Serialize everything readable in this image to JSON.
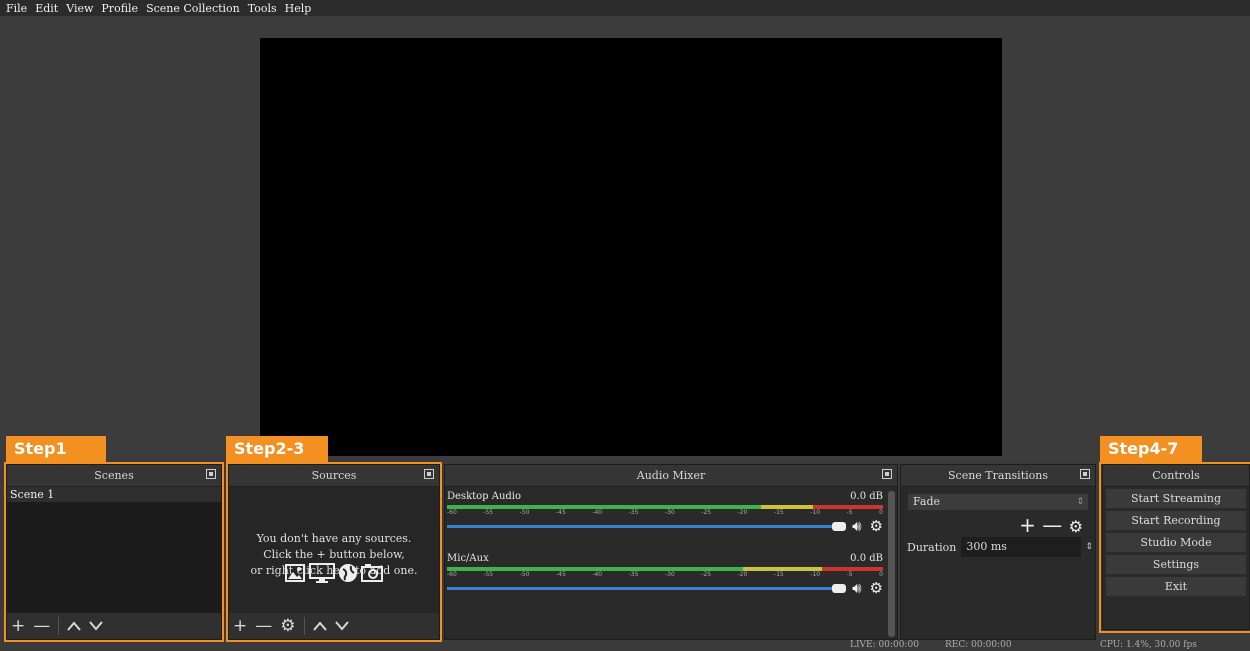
{
  "menu": [
    "File",
    "Edit",
    "View",
    "Profile",
    "Scene Collection",
    "Tools",
    "Help"
  ],
  "steps": {
    "step1": "Step1",
    "step23": "Step2-3",
    "step47": "Step4-7"
  },
  "scenes": {
    "title": "Scenes",
    "items": [
      "Scene 1"
    ]
  },
  "sources": {
    "title": "Sources",
    "empty_lines": [
      "You don't have any sources.",
      "Click the + button below,",
      "or right click here to add one."
    ]
  },
  "mixer": {
    "title": "Audio Mixer",
    "channels": [
      {
        "name": "Desktop Audio",
        "level": "0.0 dB"
      },
      {
        "name": "Mic/Aux",
        "level": "0.0 dB"
      }
    ],
    "ticks": [
      "-60",
      "-55",
      "-50",
      "-45",
      "-40",
      "-35",
      "-30",
      "-25",
      "-20",
      "-15",
      "-10",
      "-5",
      "0"
    ]
  },
  "transitions": {
    "title": "Scene Transitions",
    "selected": "Fade",
    "duration_label": "Duration",
    "duration_value": "300 ms"
  },
  "controls": {
    "title": "Controls",
    "buttons": [
      "Start Streaming",
      "Start Recording",
      "Studio Mode",
      "Settings",
      "Exit"
    ]
  },
  "status": {
    "live": "LIVE: 00:00:00",
    "rec": "REC: 00:00:00",
    "cpu": "CPU: 1.4%, 30.00 fps"
  },
  "colors": {
    "accent": "#f39021",
    "meter_green": "#3db34a",
    "meter_yellow": "#c9c43a",
    "meter_red": "#cc3333",
    "slider_blue": "#3a7fd0"
  }
}
